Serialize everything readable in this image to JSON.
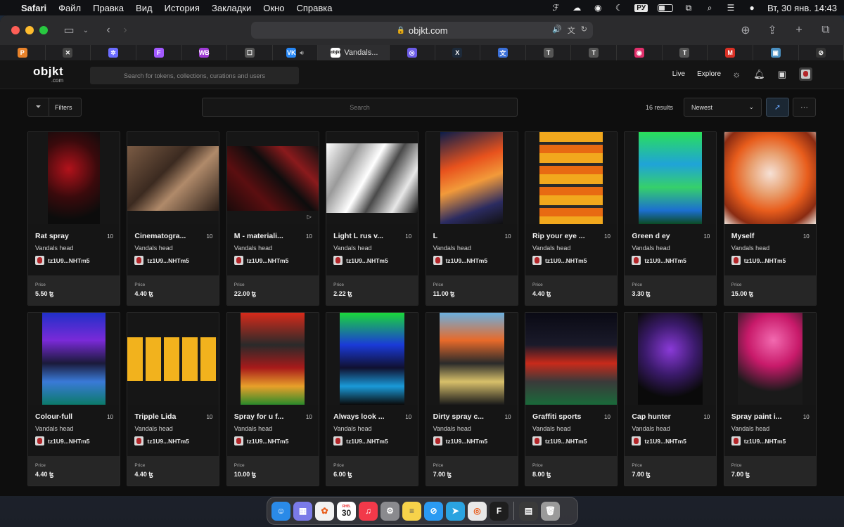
{
  "menubar": {
    "items": [
      "Safari",
      "Файл",
      "Правка",
      "Вид",
      "История",
      "Закладки",
      "Окно",
      "Справка"
    ],
    "keyboard": "РУ",
    "clock": "Вт, 30 янв.  14:43"
  },
  "browser": {
    "url": "objkt.com",
    "active_tab": "Vandals...",
    "tabs": [
      {
        "icon": "p-icon",
        "glyph": "P",
        "color": "#e8822a"
      },
      {
        "icon": "x-square-icon",
        "glyph": "✕",
        "color": "#444"
      },
      {
        "icon": "snowflake-icon",
        "glyph": "✲",
        "color": "#6b6cff"
      },
      {
        "icon": "figma-icon",
        "glyph": "F",
        "color": "#a259ff"
      },
      {
        "icon": "wb-icon",
        "glyph": "WB",
        "color": "#a03bd6"
      },
      {
        "icon": "chat-icon",
        "glyph": "☐",
        "color": "#555"
      },
      {
        "icon": "vk-icon",
        "glyph": "VK",
        "color": "#2787f5"
      },
      {
        "icon": "ring-icon",
        "glyph": "◎",
        "color": "#6c5ce7"
      },
      {
        "icon": "x-icon",
        "glyph": "X",
        "color": "#1d2a3a"
      },
      {
        "icon": "translate-icon",
        "glyph": "文",
        "color": "#3a6fd8"
      },
      {
        "icon": "t-icon",
        "glyph": "T",
        "color": "#555"
      },
      {
        "icon": "t-icon",
        "glyph": "T",
        "color": "#555"
      },
      {
        "icon": "instagram-icon",
        "glyph": "◉",
        "color": "#e1306c"
      },
      {
        "icon": "t-icon",
        "glyph": "T",
        "color": "#555"
      },
      {
        "icon": "gmail-icon",
        "glyph": "M",
        "color": "#d93025"
      },
      {
        "icon": "app-icon",
        "glyph": "▣",
        "color": "#4a90c2"
      },
      {
        "icon": "compass-icon",
        "glyph": "⊘",
        "color": "#333"
      }
    ]
  },
  "site": {
    "logo": "objkt",
    "logo_sub": ".com",
    "search_placeholder": "Search for tokens, collections, curations and users",
    "nav_live": "Live",
    "nav_explore": "Explore"
  },
  "toolbar": {
    "filters_label": "Filters",
    "search_placeholder": "Search",
    "results": "16 results",
    "sort": "Newest"
  },
  "tokens": [
    {
      "title": "Rat spray",
      "edition": "10",
      "collection": "Vandals head",
      "creator": "tz1U9...NHTm5",
      "price_label": "Price",
      "price": "5.50 ꜩ"
    },
    {
      "title": "Cinematogra...",
      "edition": "10",
      "collection": "Vandals head",
      "creator": "tz1U9...NHTm5",
      "price_label": "Price",
      "price": "4.40 ꜩ"
    },
    {
      "title": "M - materiali...",
      "edition": "10",
      "collection": "Vandals head",
      "creator": "tz1U9...NHTm5",
      "price_label": "Price",
      "price": "22.00 ꜩ"
    },
    {
      "title": "Light L rus v...",
      "edition": "10",
      "collection": "Vandals head",
      "creator": "tz1U9...NHTm5",
      "price_label": "Price",
      "price": "2.22 ꜩ"
    },
    {
      "title": "L",
      "edition": "10",
      "collection": "Vandals head",
      "creator": "tz1U9...NHTm5",
      "price_label": "Price",
      "price": "11.00 ꜩ"
    },
    {
      "title": "Rip your eye ...",
      "edition": "10",
      "collection": "Vandals head",
      "creator": "tz1U9...NHTm5",
      "price_label": "Price",
      "price": "4.40 ꜩ"
    },
    {
      "title": "Green d ey",
      "edition": "10",
      "collection": "Vandals head",
      "creator": "tz1U9...NHTm5",
      "price_label": "Price",
      "price": "3.30 ꜩ"
    },
    {
      "title": "Myself",
      "edition": "10",
      "collection": "Vandals head",
      "creator": "tz1U9...NHTm5",
      "price_label": "Price",
      "price": "15.00 ꜩ"
    },
    {
      "title": "Colour-full",
      "edition": "10",
      "collection": "Vandals head",
      "creator": "tz1U9...NHTm5",
      "price_label": "Price",
      "price": "4.40 ꜩ"
    },
    {
      "title": "Tripple Lida",
      "edition": "10",
      "collection": "Vandals head",
      "creator": "tz1U9...NHTm5",
      "price_label": "Price",
      "price": "4.40 ꜩ"
    },
    {
      "title": "Spray for u f...",
      "edition": "10",
      "collection": "Vandals head",
      "creator": "tz1U9...NHTm5",
      "price_label": "Price",
      "price": "10.00 ꜩ"
    },
    {
      "title": "Always look ...",
      "edition": "10",
      "collection": "Vandals head",
      "creator": "tz1U9...NHTm5",
      "price_label": "Price",
      "price": "6.00 ꜩ"
    },
    {
      "title": "Dirty spray c...",
      "edition": "10",
      "collection": "Vandals head",
      "creator": "tz1U9...NHTm5",
      "price_label": "Price",
      "price": "7.00 ꜩ"
    },
    {
      "title": "Graffiti sports",
      "edition": "10",
      "collection": "Vandals head",
      "creator": "tz1U9...NHTm5",
      "price_label": "Price",
      "price": "8.00 ꜩ"
    },
    {
      "title": "Cap hunter",
      "edition": "10",
      "collection": "Vandals head",
      "creator": "tz1U9...NHTm5",
      "price_label": "Price",
      "price": "7.00 ꜩ"
    },
    {
      "title": "Spray paint i...",
      "edition": "10",
      "collection": "Vandals head",
      "creator": "tz1U9...NHTm5",
      "price_label": "Price",
      "price": "7.00 ꜩ"
    }
  ],
  "dock": {
    "calendar_month": "ЯНВ.",
    "calendar_day": "30",
    "apps": [
      "finder-icon",
      "launchpad-icon",
      "photos-icon",
      "calendar-icon",
      "music-icon",
      "settings-icon",
      "notes-icon",
      "safari-icon",
      "telegram-icon",
      "chrome-icon",
      "figma-icon",
      "downloads-icon",
      "trash-icon"
    ]
  }
}
